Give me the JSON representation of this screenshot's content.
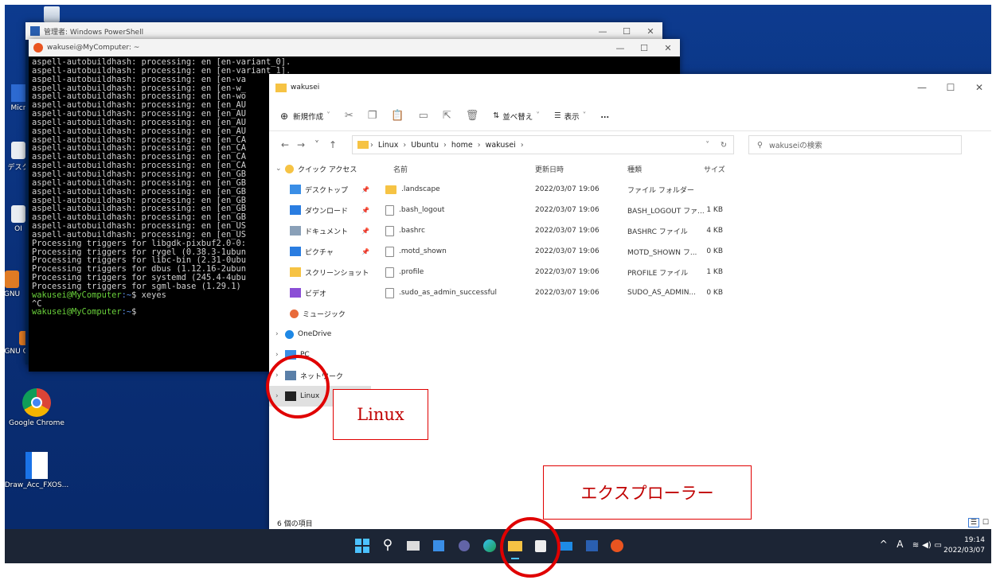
{
  "desktop_icons": [
    {
      "label": "Micr"
    },
    {
      "label": "デスク"
    },
    {
      "label": "OI"
    },
    {
      "label": "GNU"
    },
    {
      "label": "GNU Octave"
    },
    {
      "label": "Google Chrome"
    },
    {
      "label": "Draw_Acc_FXOS..."
    }
  ],
  "powershell": {
    "title": "管理者: Windows PowerShell"
  },
  "terminal": {
    "title": "wakusei@MyComputer: ~",
    "lines": [
      "aspell-autobuildhash: processing: en [en-variant_0].",
      "aspell-autobuildhash: processing: en [en-variant_1].",
      "aspell-autobuildhash: processing: en [en-va",
      "aspell-autobuildhash: processing: en [en-w_",
      "aspell-autobuildhash: processing: en [en-wo",
      "aspell-autobuildhash: processing: en [en_AU",
      "aspell-autobuildhash: processing: en [en_AU",
      "aspell-autobuildhash: processing: en [en_AU",
      "aspell-autobuildhash: processing: en [en_AU",
      "aspell-autobuildhash: processing: en [en_CA",
      "aspell-autobuildhash: processing: en [en_CA",
      "aspell-autobuildhash: processing: en [en_CA",
      "aspell-autobuildhash: processing: en [en_CA",
      "aspell-autobuildhash: processing: en [en_GB",
      "aspell-autobuildhash: processing: en [en_GB",
      "aspell-autobuildhash: processing: en [en_GB",
      "aspell-autobuildhash: processing: en [en_GB",
      "aspell-autobuildhash: processing: en [en_GB",
      "aspell-autobuildhash: processing: en [en_GB",
      "aspell-autobuildhash: processing: en [en_US",
      "aspell-autobuildhash: processing: en [en_US",
      "Processing triggers for libgdk-pixbuf2.0-0:",
      "Processing triggers for rygel (0.38.3-1ubun",
      "Processing triggers for libc-bin (2.31-0ubu",
      "Processing triggers for dbus (1.12.16-2ubun",
      "Processing triggers for systemd (245.4-4ubu",
      "Processing triggers for sgml-base (1.29.1)"
    ],
    "prompt_user": "wakusei@MyComputer",
    "prompt_path": ":~",
    "command1": "$ xeyes",
    "interrupt": "^C",
    "prompt2_tail": "$"
  },
  "explorer": {
    "title": "wakusei",
    "new_label": "新規作成",
    "sort_label": "並べ替え",
    "view_label": "表示",
    "more_label": "...",
    "breadcrumbs": [
      "Linux",
      "Ubuntu",
      "home",
      "wakusei"
    ],
    "search_placeholder": "wakuseiの検索",
    "sidebar": [
      {
        "label": "クイック アクセス",
        "top": true,
        "icon": "star"
      },
      {
        "label": "デスクトップ",
        "pin": true,
        "icon": "desktop"
      },
      {
        "label": "ダウンロード",
        "pin": true,
        "icon": "download"
      },
      {
        "label": "ドキュメント",
        "pin": true,
        "icon": "document"
      },
      {
        "label": "ピクチャ",
        "pin": true,
        "icon": "picture"
      },
      {
        "label": "スクリーンショット",
        "icon": "folder"
      },
      {
        "label": "ビデオ",
        "icon": "video"
      },
      {
        "label": "ミュージック",
        "icon": "music"
      },
      {
        "label": "OneDrive",
        "top": true,
        "icon": "cloud"
      },
      {
        "label": "PC",
        "top": true,
        "icon": "pc"
      },
      {
        "label": "ネットワーク",
        "top": true,
        "icon": "network"
      },
      {
        "label": "Linux",
        "top": true,
        "icon": "linux",
        "selected": true
      }
    ],
    "columns": [
      "名前",
      "更新日時",
      "種類",
      "サイズ"
    ],
    "files": [
      {
        "name": ".landscape",
        "date": "2022/03/07 19:06",
        "type": "ファイル フォルダー",
        "size": "",
        "folder": true
      },
      {
        "name": ".bash_logout",
        "date": "2022/03/07 19:06",
        "type": "BASH_LOGOUT ファ...",
        "size": "1 KB"
      },
      {
        "name": ".bashrc",
        "date": "2022/03/07 19:06",
        "type": "BASHRC ファイル",
        "size": "4 KB"
      },
      {
        "name": ".motd_shown",
        "date": "2022/03/07 19:06",
        "type": "MOTD_SHOWN フ...",
        "size": "0 KB"
      },
      {
        "name": ".profile",
        "date": "2022/03/07 19:06",
        "type": "PROFILE ファイル",
        "size": "1 KB"
      },
      {
        "name": ".sudo_as_admin_successful",
        "date": "2022/03/07 19:06",
        "type": "SUDO_AS_ADMIN...",
        "size": "0 KB"
      }
    ],
    "status": "6 個の項目"
  },
  "annotations": {
    "linux_label": "Linux",
    "explorer_label": "エクスプローラー"
  },
  "taskbar": {
    "ime": "A",
    "time": "19:14",
    "date": "2022/03/07"
  }
}
